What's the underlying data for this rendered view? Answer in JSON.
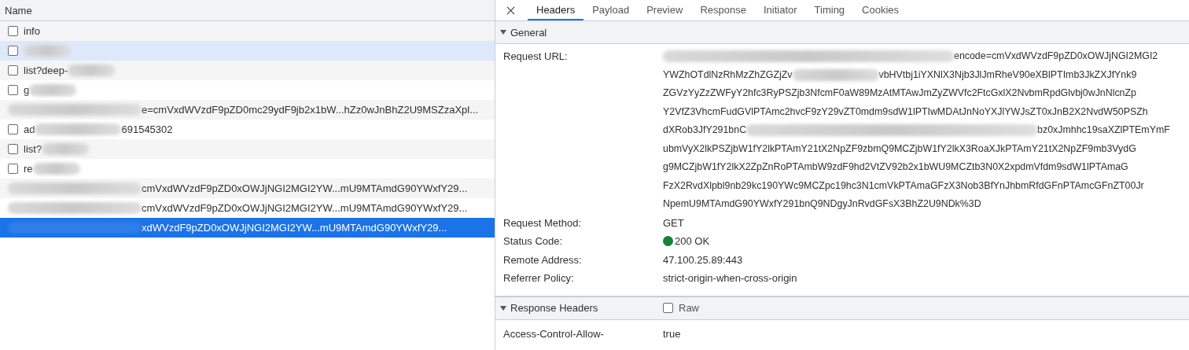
{
  "requests": {
    "column": "Name",
    "rows": [
      {
        "checked": false,
        "hovered": false,
        "selected": false,
        "segments": [
          {
            "kind": "text",
            "text": "info"
          }
        ]
      },
      {
        "checked": false,
        "hovered": true,
        "selected": false,
        "segments": [
          {
            "kind": "blur"
          }
        ]
      },
      {
        "checked": false,
        "hovered": false,
        "selected": false,
        "segments": [
          {
            "kind": "text",
            "text": "list?deep-"
          },
          {
            "kind": "blur"
          }
        ]
      },
      {
        "checked": false,
        "hovered": false,
        "selected": false,
        "segments": [
          {
            "kind": "text",
            "text": "g"
          },
          {
            "kind": "blur"
          }
        ]
      },
      {
        "hovered": false,
        "selected": false,
        "segments": [
          {
            "kind": "blur"
          },
          {
            "kind": "text",
            "text": "e=cmVxdWVzdF9pZD0mc29ydF9jb2x1bW...hZz0wJnBhZ2U9MSZzaXpl..."
          }
        ]
      },
      {
        "checked": false,
        "hovered": false,
        "selected": false,
        "segments": [
          {
            "kind": "text",
            "text": "ad"
          },
          {
            "kind": "blur"
          },
          {
            "kind": "text",
            "text": "691545302"
          }
        ]
      },
      {
        "checked": false,
        "hovered": false,
        "selected": false,
        "segments": [
          {
            "kind": "text",
            "text": "list?"
          },
          {
            "kind": "blur"
          }
        ]
      },
      {
        "checked": false,
        "hovered": false,
        "selected": false,
        "segments": [
          {
            "kind": "text",
            "text": "re"
          },
          {
            "kind": "blur"
          }
        ]
      },
      {
        "hovered": false,
        "selected": false,
        "segments": [
          {
            "kind": "blur"
          },
          {
            "kind": "text",
            "text": "cmVxdWVzdF9pZD0xOWJjNGI2MGI2YW...mU9MTAmdG90YWxfY29..."
          }
        ]
      },
      {
        "hovered": false,
        "selected": false,
        "segments": [
          {
            "kind": "blur"
          },
          {
            "kind": "text",
            "text": "cmVxdWVzdF9pZD0xOWJjNGI2MGI2YW...mU9MTAmdG90YWxfY29..."
          }
        ]
      },
      {
        "hovered": false,
        "selected": true,
        "segments": [
          {
            "kind": "blur"
          },
          {
            "kind": "text",
            "text": "xdWVzdF9pZD0xOWJjNGI2MGI2YW...mU9MTAmdG90YWxfY29..."
          }
        ]
      }
    ]
  },
  "tabs": [
    {
      "label": "Headers",
      "selected": true
    },
    {
      "label": "Payload",
      "selected": false
    },
    {
      "label": "Preview",
      "selected": false
    },
    {
      "label": "Response",
      "selected": false
    },
    {
      "label": "Initiator",
      "selected": false
    },
    {
      "label": "Timing",
      "selected": false
    },
    {
      "label": "Cookies",
      "selected": false
    }
  ],
  "general": {
    "title": "General",
    "expanded": true,
    "url_label": "Request URL:",
    "url_lines": [
      [
        {
          "kind": "blur"
        },
        {
          "kind": "text",
          "text": "encode=cmVxdWVzdF9pZD0xOWJjNGI2MGI2"
        }
      ],
      [
        {
          "kind": "text",
          "text": "YWZhOTdlNzRhMzZhZGZjZv"
        },
        {
          "kind": "blur"
        },
        {
          "kind": "text",
          "text": "vbHVtbj1iYXNlX3Njb3JlJmRheV90eXBlPTImb3JkZXJfYnk9"
        }
      ],
      [
        {
          "kind": "text",
          "text": "ZGVzYyZzZWFyY2hfc3RyPSZjb3NfcmF0aW89MzAtMTAwJmZyZWVfc2FtcGxlX2NvbmRpdGlvbj0wJnNlcnZp"
        }
      ],
      [
        {
          "kind": "text",
          "text": "Y2VfZ3VhcmFudGVlPTAmc2hvcF9zY29vZT0mdm9sdW1lPTIwMDAtJnNoYXJlYWJsZT0xJnB2X2NvdW50PSZh"
        }
      ],
      [
        {
          "kind": "text",
          "text": "dXRob3JfY291bnC"
        },
        {
          "kind": "blur"
        },
        {
          "kind": "text",
          "text": "bz0xJmhhc19saXZlPTEmYmF"
        }
      ],
      [
        {
          "kind": "text",
          "text": "ubmVyX2lkPSZjbW1fY2lkPTAmY21tX2NpZF9zbmQ9MCZjbW1fY2lkX3RoaXJkPTAmY21tX2NpZF9mb3VydG"
        }
      ],
      [
        {
          "kind": "text",
          "text": "g9MCZjbW1fY2lkX2ZpZnRoPTAmbW9zdF9hd2VtZV92b2x1bWU9MCZtb3N0X2xpdmVfdm9sdW1lPTAmaG"
        }
      ],
      [
        {
          "kind": "text",
          "text": "FzX2RvdXlpbl9nb29kc190YWc9MCZpc19hc3N1cmVkPTAmaGFzX3Nob3BfYnJhbmRfdGFnPTAmcGFnZT00Jr"
        }
      ],
      [
        {
          "kind": "text",
          "text": "NpemU9MTAmdG90YWxfY291bnQ9NDgyJnRvdGFsX3BhZ2U9NDk%3D"
        }
      ]
    ],
    "fields": [
      {
        "label": "Request Method:",
        "value": "GET"
      },
      {
        "label": "Status Code:",
        "value": "200 OK",
        "color": "#188038"
      },
      {
        "label": "Remote Address:",
        "value": "47.100.25.89:443"
      },
      {
        "label": "Referrer Policy:",
        "value": "strict-origin-when-cross-origin"
      }
    ]
  },
  "response_headers": {
    "title": "Response Headers",
    "expanded": true,
    "raw_label": "Raw",
    "raw_checked": false,
    "fields": [
      {
        "label": "Access-Control-Allow-",
        "value": "true"
      }
    ]
  }
}
